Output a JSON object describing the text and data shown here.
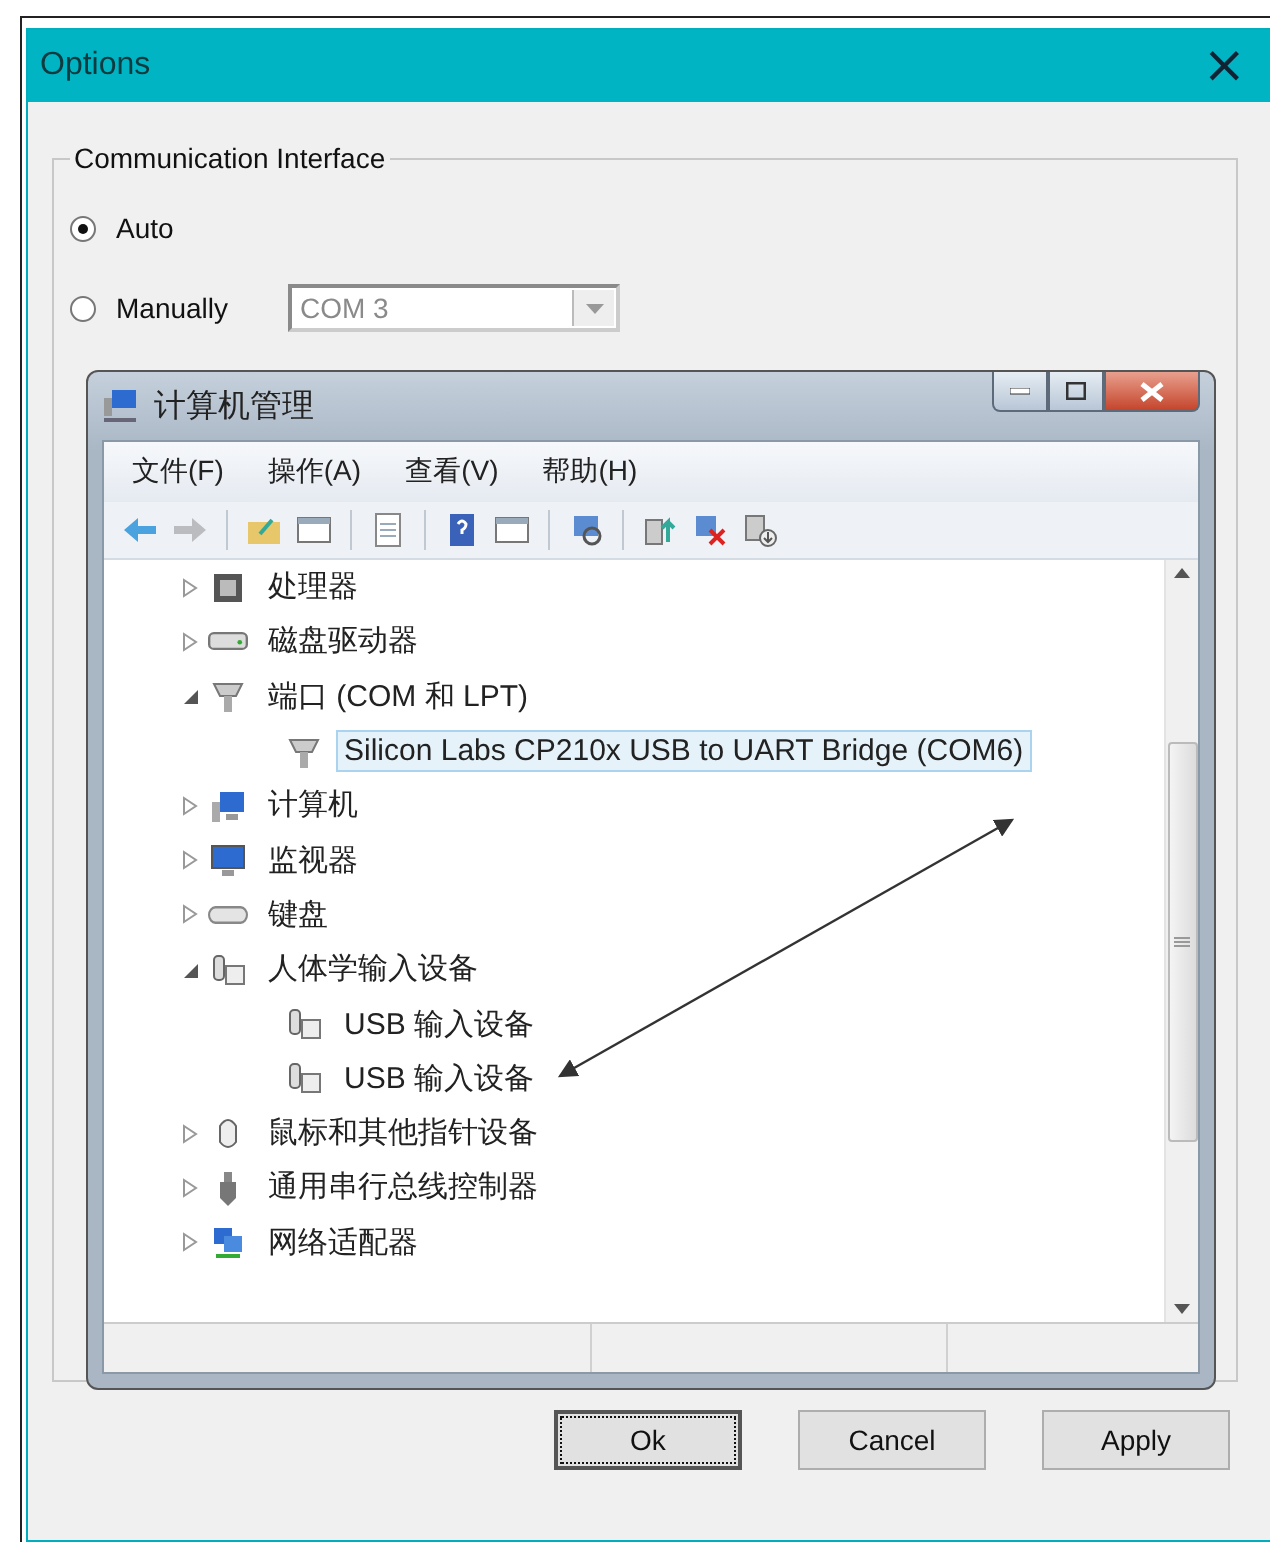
{
  "window": {
    "title": "Options",
    "close": "×"
  },
  "group": {
    "legend": "Communication Interface"
  },
  "radios": [
    {
      "label": "Auto",
      "selected": true
    },
    {
      "label": "Manually",
      "selected": false
    }
  ],
  "port_select": {
    "value": "COM 3",
    "disabled": true
  },
  "embedded_window": {
    "title": "计算机管理",
    "menu": [
      "文件(F)",
      "操作(A)",
      "查看(V)",
      "帮助(H)"
    ],
    "toolbar": [
      {
        "kind": "back",
        "disabled": false
      },
      {
        "kind": "forward",
        "disabled": true
      },
      {
        "kind": "separator"
      },
      {
        "kind": "folder"
      },
      {
        "kind": "panel"
      },
      {
        "kind": "separator"
      },
      {
        "kind": "page"
      },
      {
        "kind": "separator"
      },
      {
        "kind": "help"
      },
      {
        "kind": "panel"
      },
      {
        "kind": "separator"
      },
      {
        "kind": "scan"
      },
      {
        "kind": "separator"
      },
      {
        "kind": "update"
      },
      {
        "kind": "remove"
      },
      {
        "kind": "install"
      }
    ],
    "tree": [
      {
        "label": "处理器",
        "kind": "cpu",
        "expanded": false,
        "selected": false
      },
      {
        "label": "磁盘驱动器",
        "kind": "disk",
        "expanded": false,
        "selected": false
      },
      {
        "label": "端口 (COM 和 LPT)",
        "kind": "port",
        "expanded": true,
        "selected": false,
        "children": [
          {
            "label": "Silicon Labs CP210x USB to UART Bridge (COM6)",
            "kind": "port",
            "selected": true
          }
        ]
      },
      {
        "label": "计算机",
        "kind": "computer",
        "expanded": false,
        "selected": false
      },
      {
        "label": "监视器",
        "kind": "monitor",
        "expanded": false,
        "selected": false
      },
      {
        "label": "键盘",
        "kind": "keyboard",
        "expanded": false,
        "selected": false
      },
      {
        "label": "人体学输入设备",
        "kind": "hid",
        "expanded": true,
        "selected": false,
        "children": [
          {
            "label": "USB 输入设备",
            "kind": "hid",
            "selected": false
          },
          {
            "label": "USB 输入设备",
            "kind": "hid",
            "selected": false
          }
        ]
      },
      {
        "label": "鼠标和其他指针设备",
        "kind": "mouse",
        "expanded": false,
        "selected": false
      },
      {
        "label": "通用串行总线控制器",
        "kind": "usb",
        "expanded": false,
        "selected": false
      },
      {
        "label": "网络适配器",
        "kind": "network",
        "expanded": false,
        "selected": false
      }
    ]
  },
  "buttons": [
    {
      "label": "Ok",
      "focused": true
    },
    {
      "label": "Cancel",
      "focused": false
    },
    {
      "label": "Apply",
      "focused": false
    }
  ]
}
